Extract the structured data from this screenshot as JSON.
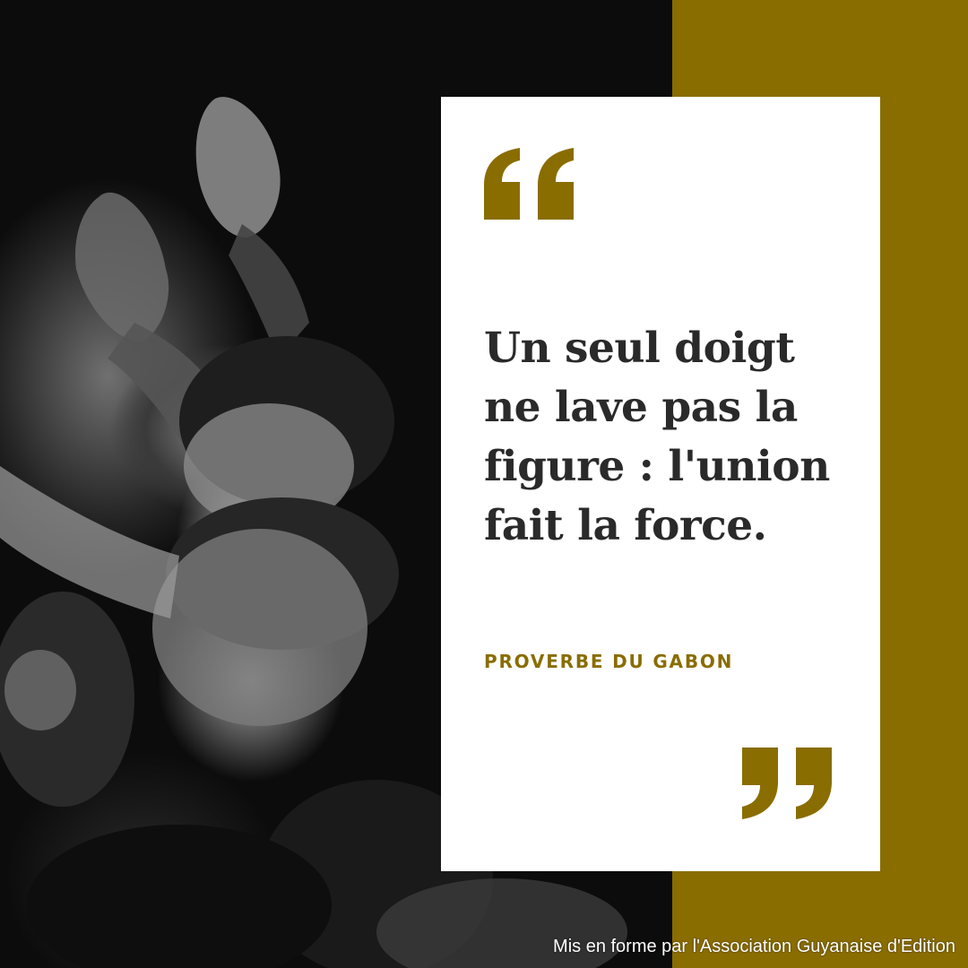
{
  "quote": {
    "text": "Un seul doigt ne lave pas la figure : l'union fait la force.",
    "attribution": "PROVERBE DU GABON"
  },
  "credit": "Mis en forme par l'Association Guyanaise d'Edition",
  "colors": {
    "accent": "#8a6d00",
    "card": "#ffffff",
    "text": "#2a2a2a"
  },
  "icons": {
    "open_quote": "opening-quotation-mark",
    "close_quote": "closing-quotation-mark"
  }
}
